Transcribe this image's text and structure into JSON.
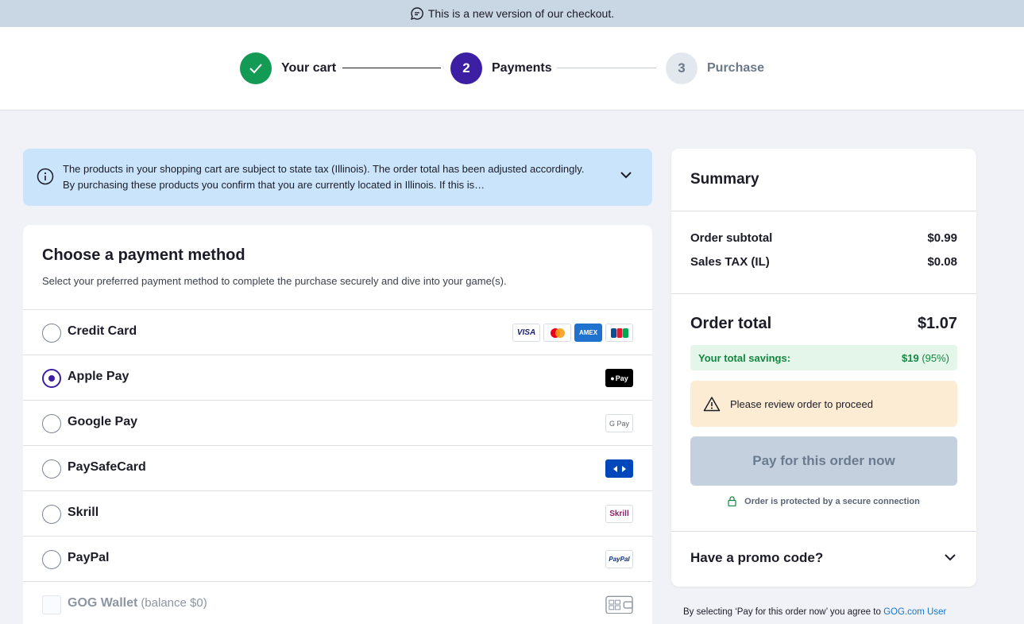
{
  "banner": {
    "text": "This is a new version of our checkout.",
    "icon": "chat-bubble-icon"
  },
  "steps": [
    {
      "number": "",
      "label": "Your cart",
      "state": "done"
    },
    {
      "number": "2",
      "label": "Payments",
      "state": "active"
    },
    {
      "number": "3",
      "label": "Purchase",
      "state": "upcoming"
    }
  ],
  "tax_notice": {
    "text": "The products in your shopping cart are subject to state tax (Illinois). The order total has been adjusted accordingly. By purchasing these products you confirm that you are currently located in Illinois. If this is…"
  },
  "payment": {
    "title": "Choose a payment method",
    "subtitle": "Select your preferred payment method to complete the purchase securely and dive into your game(s).",
    "methods": [
      {
        "label": "Credit Card",
        "selected": false,
        "logos": [
          "VISA",
          "mastercard",
          "AMEX",
          "JCB"
        ]
      },
      {
        "label": "Apple Pay",
        "selected": true,
        "logos": [
          "Pay"
        ]
      },
      {
        "label": "Google Pay",
        "selected": false,
        "logos": [
          "G Pay"
        ]
      },
      {
        "label": "PaySafeCard",
        "selected": false,
        "logos": [
          "paysafecard"
        ]
      },
      {
        "label": "Skrill",
        "selected": false,
        "logos": [
          "Skrill"
        ]
      },
      {
        "label": "PayPal",
        "selected": false,
        "logos": [
          "PayPal"
        ]
      },
      {
        "label": "GOG Wallet",
        "balance": "(balance $0)",
        "disabled": true,
        "logos": [
          "gog-wallet"
        ]
      }
    ]
  },
  "summary": {
    "title": "Summary",
    "subtotal_label": "Order subtotal",
    "subtotal_value": "$0.99",
    "tax_label": "Sales TAX (IL)",
    "tax_value": "$0.08",
    "total_label": "Order total",
    "total_value": "$1.07",
    "savings_label": "Your total savings:",
    "savings_value": "$19",
    "savings_pct": "(95%)",
    "warning": "Please review order to proceed",
    "pay_button": "Pay for this order now",
    "secure_text": "Order is protected by a secure connection",
    "promo_label": "Have a promo code?"
  },
  "footer": {
    "text": "By selecting ‘Pay for this order now’ you agree to ",
    "link": "GOG.com User"
  },
  "colors": {
    "accent": "#3d1fa3",
    "success": "#139a55",
    "info_bg": "#c9e4fb",
    "warn_bg": "#fdecd4"
  }
}
